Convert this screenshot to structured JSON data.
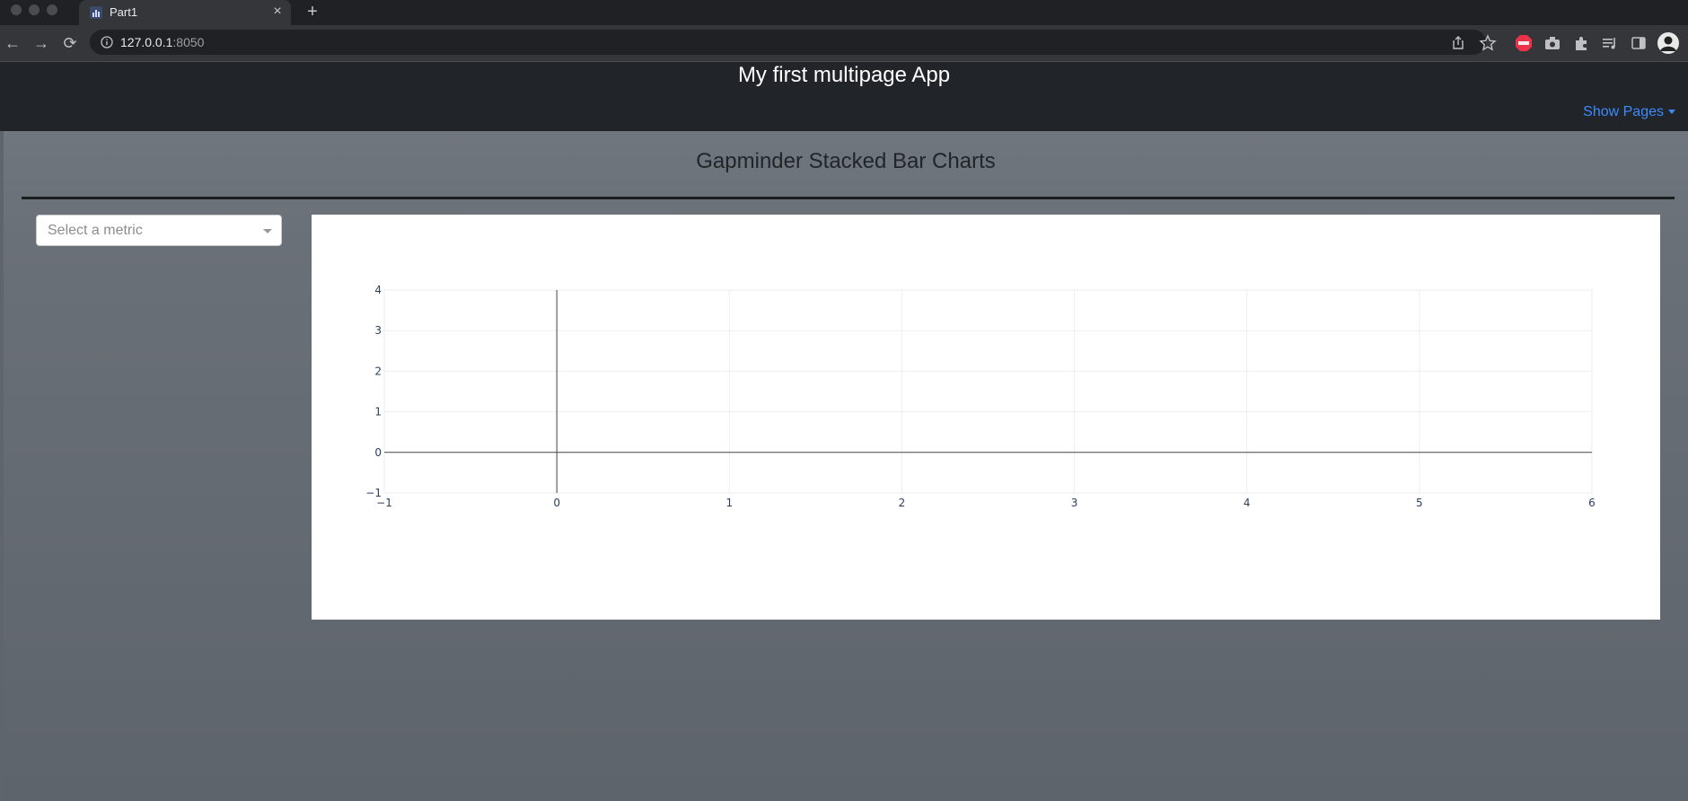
{
  "browser": {
    "tab_title": "Part1",
    "url_host": "127.0.0.1",
    "url_port": ":8050",
    "close_glyph": "×",
    "new_tab_glyph": "+",
    "back_glyph": "←",
    "forward_glyph": "→",
    "reload_glyph": "⟳",
    "extensions": [
      "share-icon",
      "star-icon",
      "adblock-icon",
      "camera-icon",
      "puzzle-icon",
      "media-icon",
      "sidepanel-icon",
      "profile-avatar"
    ]
  },
  "header": {
    "title": "My first multipage App",
    "nav_label": "Show Pages"
  },
  "main": {
    "heading": "Gapminder Stacked Bar Charts",
    "metric_select": {
      "placeholder": "Select a metric",
      "value": ""
    }
  },
  "colors": {
    "nav_link": "#3d8bfd",
    "header_bg": "#212428",
    "page_bg": "#6a7077",
    "graph_bg": "#ffffff"
  },
  "chart_data": {
    "type": "bar",
    "series": [],
    "xlim": [
      -1,
      6
    ],
    "ylim": [
      -1,
      4
    ],
    "x_ticks": [
      "−1",
      "0",
      "1",
      "2",
      "3",
      "4",
      "5",
      "6"
    ],
    "y_ticks": [
      "−1",
      "0",
      "1",
      "2",
      "3",
      "4"
    ],
    "x_tick_values": [
      -1,
      0,
      1,
      2,
      3,
      4,
      5,
      6
    ],
    "y_tick_values": [
      -1,
      0,
      1,
      2,
      3,
      4
    ],
    "grid": true,
    "title": "",
    "xlabel": "",
    "ylabel": ""
  }
}
